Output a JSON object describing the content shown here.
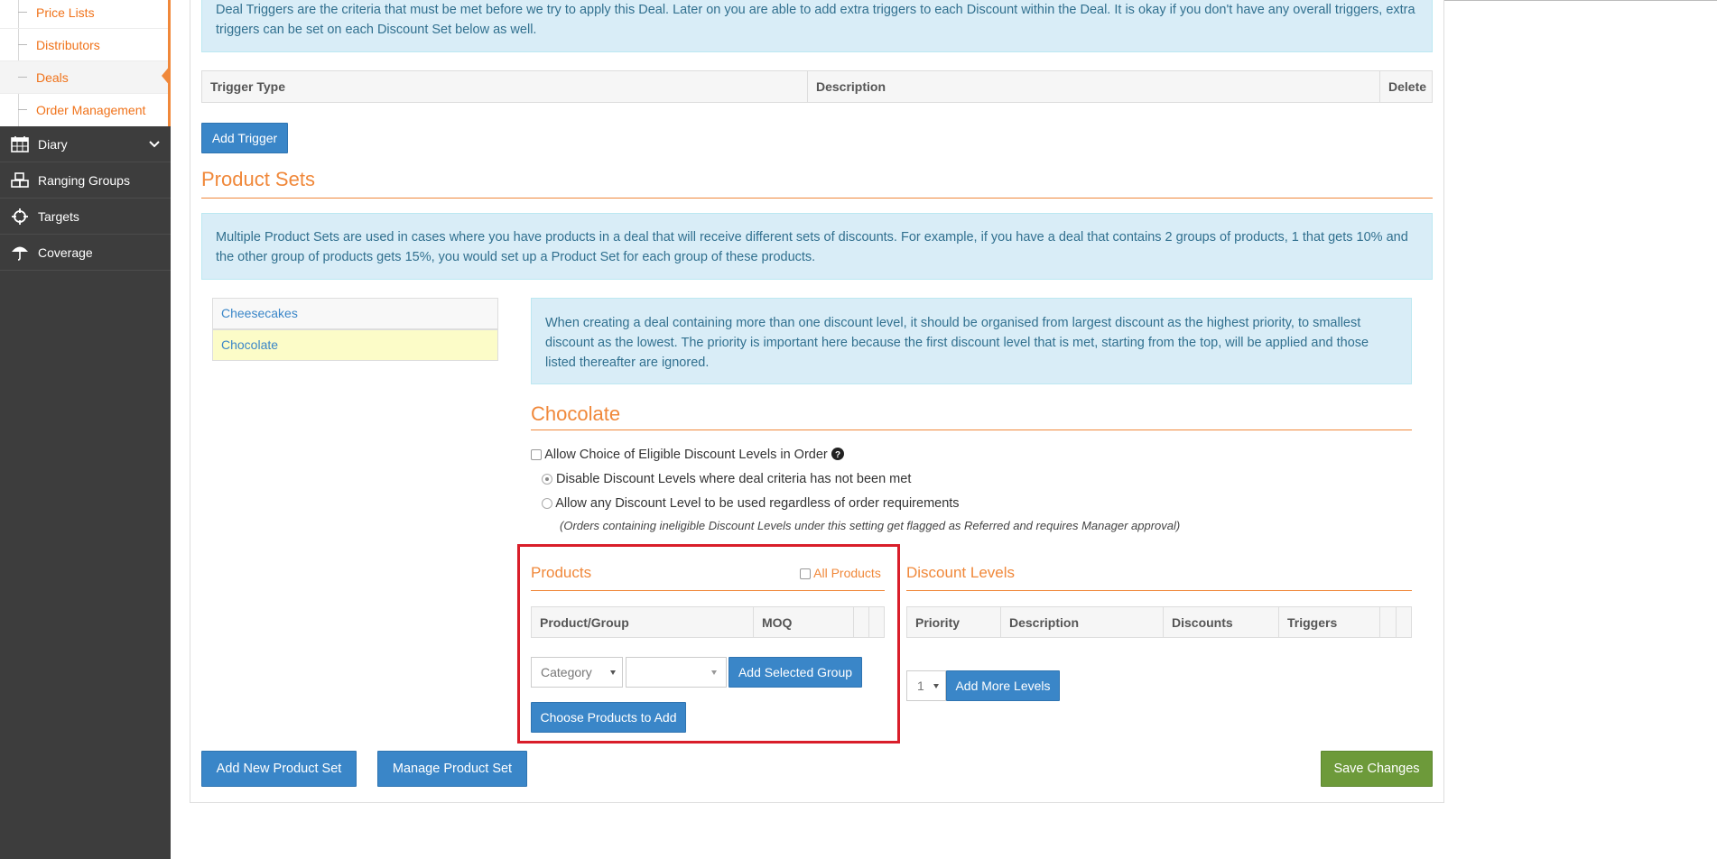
{
  "sidebar": {
    "sub_items": [
      {
        "label": "Price Lists"
      },
      {
        "label": "Distributors"
      },
      {
        "label": "Deals"
      },
      {
        "label": "Order Management"
      }
    ],
    "nav_items": [
      {
        "label": "Diary",
        "icon": "calendar-icon"
      },
      {
        "label": "Ranging Groups",
        "icon": "cubes-icon"
      },
      {
        "label": "Targets",
        "icon": "crosshair-icon"
      },
      {
        "label": "Coverage",
        "icon": "umbrella-icon"
      }
    ]
  },
  "triggers": {
    "info": "Deal Triggers are the criteria that must be met before we try to apply this Deal. Later on you are able to add extra triggers to each Discount within the Deal. It is okay if you don't have any overall triggers, extra triggers can be set on each Discount Set below as well.",
    "columns": [
      "Trigger Type",
      "Description",
      "Delete"
    ],
    "add_button": "Add Trigger"
  },
  "product_sets": {
    "title": "Product Sets",
    "info": "Multiple Product Sets are used in cases where you have products in a deal that will receive different sets of discounts. For example, if you have a deal that contains 2 groups of products, 1 that gets 10% and the other group of products gets 15%, you would set up a Product Set for each group of these products.",
    "sets": [
      {
        "label": "Cheesecakes"
      },
      {
        "label": "Chocolate"
      }
    ],
    "add_button": "Add New Product Set",
    "manage_button": "Manage Product Set",
    "save_button": "Save Changes"
  },
  "detail": {
    "info": "When creating a deal containing more than one discount level, it should be organised from largest discount as the highest priority, to smallest discount as the lowest. The priority is important here because the first discount level that is met, starting from the top, will be applied and those listed thereafter are ignored.",
    "title": "Chocolate",
    "allow_choice_label": "Allow Choice of Eligible Discount Levels in Order",
    "option_disable": "Disable Discount Levels where deal criteria has not been met",
    "option_allow": "Allow any Discount Level to be used regardless of order requirements",
    "note": "(Orders containing ineligible Discount Levels under this setting get flagged as Referred and requires Manager approval)"
  },
  "products": {
    "title": "Products",
    "all_products_label": "All Products",
    "columns": [
      "Product/Group",
      "MOQ",
      "",
      ""
    ],
    "category_select": "Category",
    "group_select": "",
    "add_group_button": "Add Selected Group",
    "choose_button": "Choose Products to Add"
  },
  "discount_levels": {
    "title": "Discount Levels",
    "columns": [
      "Priority",
      "Description",
      "Discounts",
      "Triggers",
      "",
      ""
    ],
    "levels_select": "1",
    "add_levels_button": "Add More Levels"
  },
  "colors": {
    "accent": "#f0883a",
    "primary_button": "#3a86c8",
    "save_button": "#6d9a3a",
    "highlight": "#d91e2a",
    "sidebar": "#3d3d3d"
  }
}
